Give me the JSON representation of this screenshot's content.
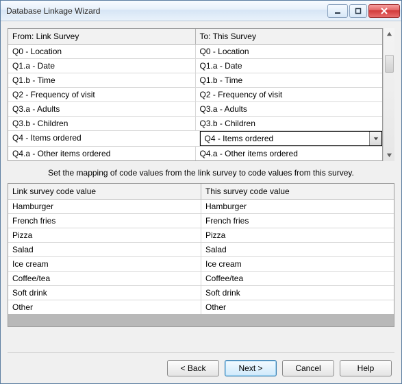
{
  "window": {
    "title": "Database Linkage Wizard"
  },
  "topTable": {
    "headerLeft": "From: Link Survey",
    "headerRight": "To: This Survey",
    "rows": [
      {
        "left": "Q0 - Location",
        "right": "Q0 - Location"
      },
      {
        "left": "Q1.a - Date",
        "right": "Q1.a - Date"
      },
      {
        "left": "Q1.b - Time",
        "right": "Q1.b - Time"
      },
      {
        "left": "Q2 - Frequency of visit",
        "right": "Q2 - Frequency of visit"
      },
      {
        "left": "Q3.a - Adults",
        "right": "Q3.a - Adults"
      },
      {
        "left": "Q3.b - Children",
        "right": "Q3.b - Children"
      },
      {
        "left": "Q4 - Items ordered",
        "right": "Q4 - Items ordered"
      },
      {
        "left": "Q4.a - Other items ordered",
        "right": "Q4.a - Other items ordered"
      }
    ],
    "selectedIndex": 6
  },
  "instruction": "Set the mapping of code values from the link survey to code values from this survey.",
  "codeTable": {
    "headerLeft": "Link survey code value",
    "headerRight": "This survey code value",
    "rows": [
      {
        "left": "Hamburger",
        "right": "Hamburger"
      },
      {
        "left": "French fries",
        "right": "French fries"
      },
      {
        "left": "Pizza",
        "right": "Pizza"
      },
      {
        "left": "Salad",
        "right": "Salad"
      },
      {
        "left": "Ice cream",
        "right": "Ice cream"
      },
      {
        "left": "Coffee/tea",
        "right": "Coffee/tea"
      },
      {
        "left": "Soft drink",
        "right": "Soft drink"
      },
      {
        "left": "Other",
        "right": "Other"
      }
    ]
  },
  "buttons": {
    "back": "< Back",
    "next": "Next >",
    "cancel": "Cancel",
    "help": "Help"
  }
}
